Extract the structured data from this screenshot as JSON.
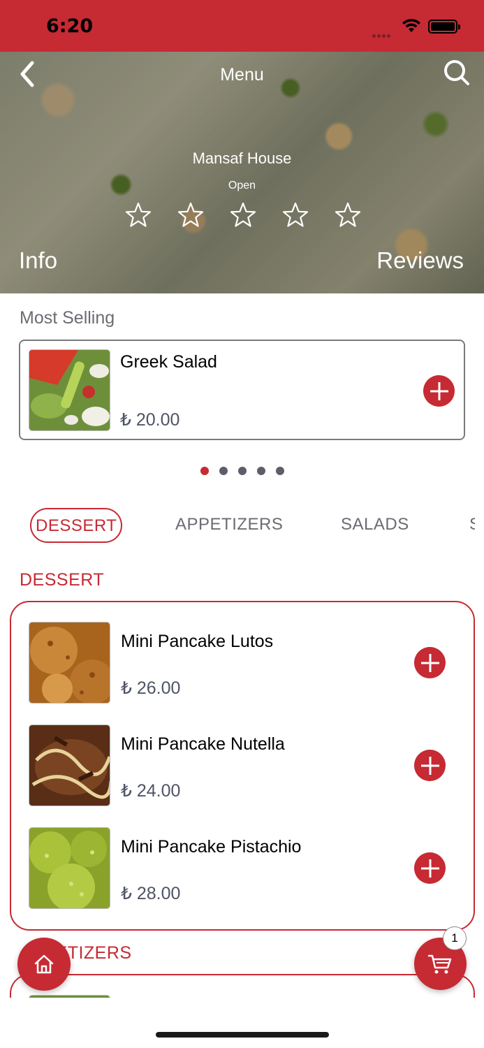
{
  "status_bar": {
    "time": "6:20"
  },
  "header": {
    "title": "Menu",
    "restaurant_name": "Mansaf House",
    "restaurant_status": "Open",
    "rating_stars": 5,
    "rating_filled": 0,
    "info_label": "Info",
    "reviews_label": "Reviews"
  },
  "most_selling": {
    "label": "Most Selling",
    "item": {
      "name": "Greek Salad",
      "price": "₺ 20.00"
    },
    "carousel_pages": 5,
    "carousel_active": 0
  },
  "tabs": [
    {
      "label": "DESSERT",
      "active": true
    },
    {
      "label": "APPETIZERS",
      "active": false
    },
    {
      "label": "SALADS",
      "active": false
    },
    {
      "label": "S",
      "active": false
    }
  ],
  "sections": [
    {
      "title": "DESSERT",
      "items": [
        {
          "name": "Mini Pancake Lutos",
          "price": "₺ 26.00"
        },
        {
          "name": "Mini Pancake Nutella",
          "price": "₺ 24.00"
        },
        {
          "name": "Mini Pancake Pistachio",
          "price": "₺ 28.00"
        }
      ]
    },
    {
      "title": "APPETIZERS",
      "items": []
    }
  ],
  "cart": {
    "count": "1"
  },
  "colors": {
    "accent": "#c62a33",
    "price": "#4f5466",
    "muted": "#6b6b73"
  },
  "icons": [
    "back-icon",
    "search-icon",
    "star-icon",
    "plus-icon",
    "home-icon",
    "cart-icon"
  ]
}
